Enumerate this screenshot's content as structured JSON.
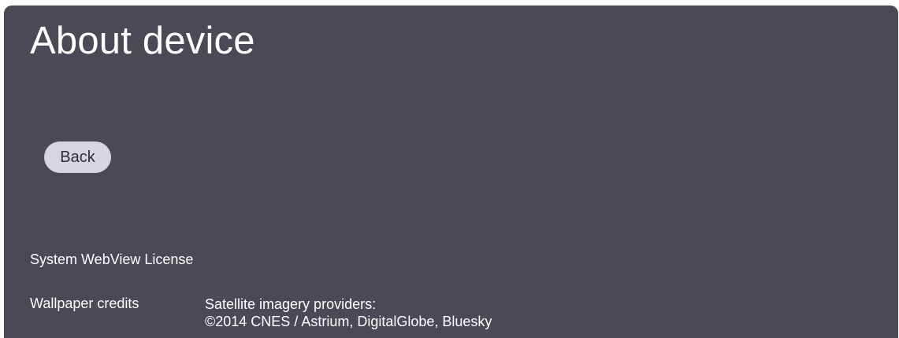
{
  "page": {
    "title": "About device"
  },
  "actions": {
    "back_label": "Back"
  },
  "rows": {
    "webview_license": "System WebView License",
    "wallpaper_label": "Wallpaper credits",
    "wallpaper_value_line1": "Satellite imagery providers:",
    "wallpaper_value_line2": "©2014 CNES / Astrium, DigitalGlobe, Bluesky"
  },
  "colors": {
    "panel_background": "#494a55",
    "button_background": "#d7d5df",
    "text": "#ffffff"
  }
}
